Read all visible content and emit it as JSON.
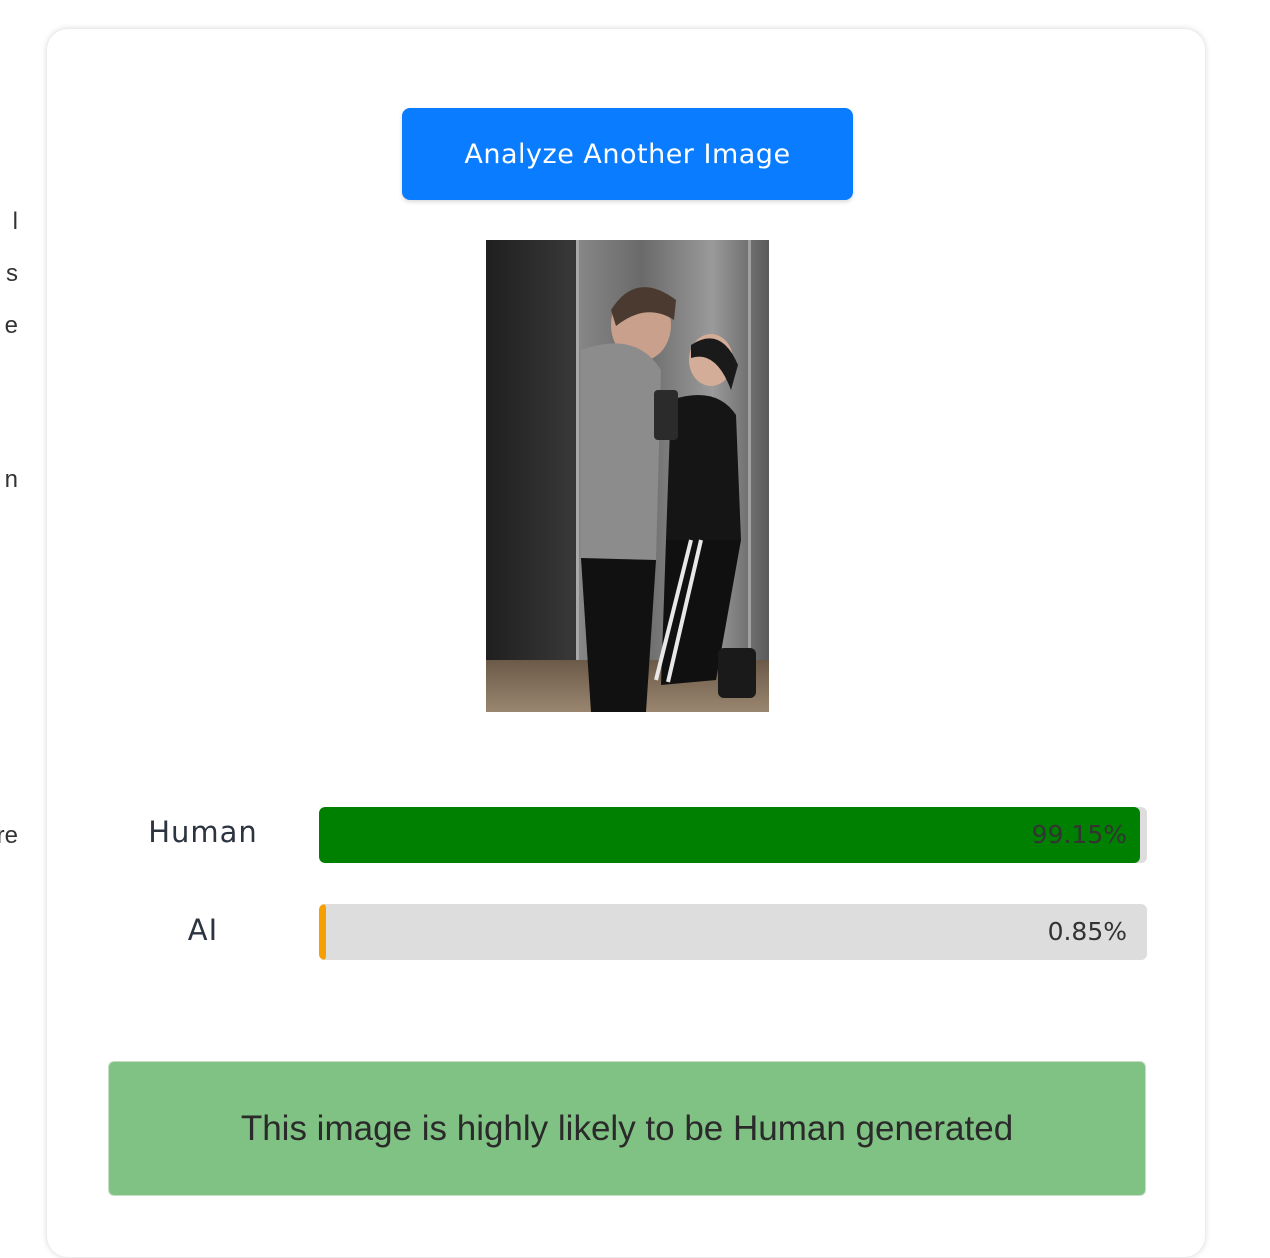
{
  "left_fragments": [
    "l",
    "s",
    "e",
    "n",
    "re"
  ],
  "analyze_button": {
    "label": "Analyze Another Image"
  },
  "photo": {
    "description_icon": "uploaded-photo"
  },
  "results": [
    {
      "label": "Human",
      "value_text": "99.15%",
      "percent": 99.15,
      "color": "#008000"
    },
    {
      "label": "AI",
      "value_text": "0.85%",
      "percent": 0.85,
      "color": "#f5a000"
    }
  ],
  "verdict": {
    "text": "This image is highly likely to be Human generated",
    "color": "#80c283"
  }
}
